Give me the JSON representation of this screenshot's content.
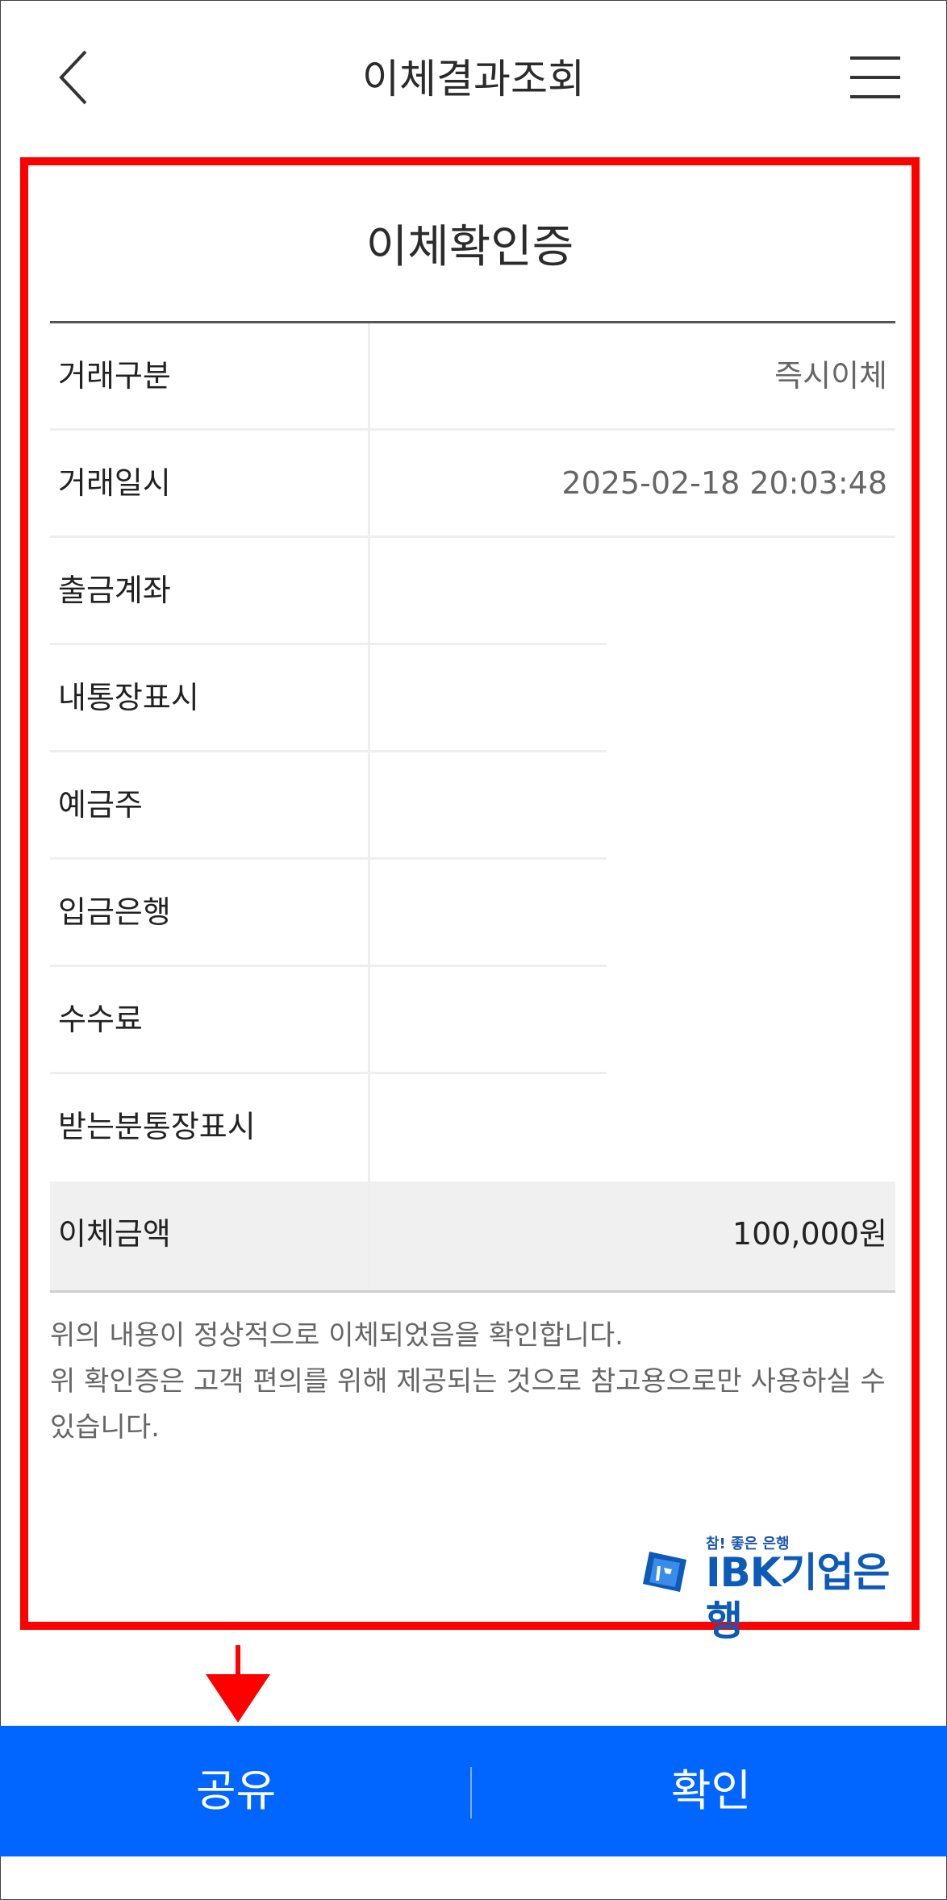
{
  "header": {
    "title": "이체결과조회",
    "back_icon": "chevron-left-icon",
    "menu_icon": "hamburger-menu-icon"
  },
  "card": {
    "title": "이체확인증",
    "rows": [
      {
        "label": "거래구분",
        "value": "즉시이체"
      },
      {
        "label": "거래일시",
        "value": "2025-02-18 20:03:48"
      },
      {
        "label": "출금계좌",
        "value": ""
      },
      {
        "label": "내통장표시",
        "value": ""
      },
      {
        "label": "예금주",
        "value": ""
      },
      {
        "label": "입금은행",
        "value": ""
      },
      {
        "label": "수수료",
        "value": ""
      },
      {
        "label": "받는분통장표시",
        "value": ""
      }
    ],
    "amount": {
      "label": "이체금액",
      "value": "100,000원"
    },
    "notice_line1": "위의 내용이 정상적으로 이체되었음을 확인합니다.",
    "notice_line2": "위 확인증은 고객 편의를 위해 제공되는 것으로 참고용으로만 사용하실 수 있습니다."
  },
  "logo": {
    "tagline": "참! 좋은 은행",
    "brand": "IBK기업은행",
    "color": "#0d5ab8"
  },
  "bottom_bar": {
    "share_label": "공유",
    "confirm_label": "확인",
    "color": "#0066ff"
  },
  "colors": {
    "highlight_border": "#ff0000",
    "arrow": "#ff0000"
  }
}
